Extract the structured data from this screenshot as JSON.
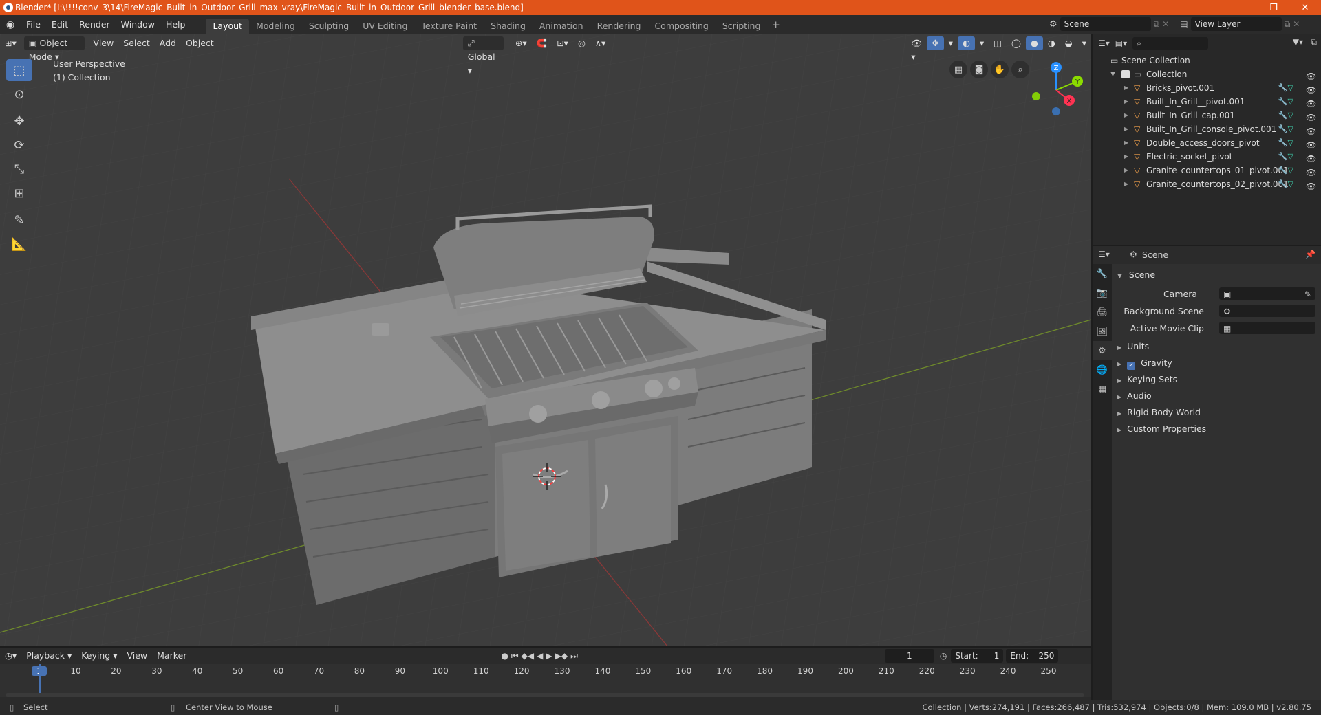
{
  "window": {
    "title": "Blender* [I:\\!!!!conv_3\\14\\FireMagic_Built_in_Outdoor_Grill_max_vray\\FireMagic_Built_in_Outdoor_Grill_blender_base.blend]",
    "controls": [
      "–",
      "❐",
      "✕"
    ]
  },
  "menu": [
    "File",
    "Edit",
    "Render",
    "Window",
    "Help"
  ],
  "workspaces": [
    "Layout",
    "Modeling",
    "Sculpting",
    "UV Editing",
    "Texture Paint",
    "Shading",
    "Animation",
    "Rendering",
    "Compositing",
    "Scripting"
  ],
  "active_workspace": "Layout",
  "scene_field": "Scene",
  "view_layer_field": "View Layer",
  "viewport": {
    "mode": "Object Mode",
    "menus": [
      "View",
      "Select",
      "Add",
      "Object"
    ],
    "transform_orientation": "Global",
    "perspective_label": "User Perspective",
    "collection_label": "(1) Collection",
    "gizmo": {
      "z": "Z",
      "y": "Y",
      "x": "X"
    }
  },
  "outliner": {
    "root": "Scene Collection",
    "collection": "Collection",
    "items": [
      "Bricks_pivot.001",
      "Built_In_Grill__pivot.001",
      "Built_In_Grill_cap.001",
      "Built_In_Grill_console_pivot.001",
      "Double_access_doors_pivot",
      "Electric_socket_pivot",
      "Granite_countertops_01_pivot.001",
      "Granite_countertops_02_pivot.001"
    ]
  },
  "properties": {
    "header": "Scene",
    "section": "Scene",
    "fields": [
      {
        "label": "Camera"
      },
      {
        "label": "Background Scene"
      },
      {
        "label": "Active Movie Clip"
      }
    ],
    "panels": [
      "Units",
      "Gravity",
      "Keying Sets",
      "Audio",
      "Rigid Body World",
      "Custom Properties"
    ]
  },
  "timeline": {
    "menus": [
      "Playback",
      "Keying",
      "View",
      "Marker"
    ],
    "current_frame": "1",
    "start_label": "Start:",
    "start": "1",
    "end_label": "End:",
    "end": "250",
    "ruler": [
      "1",
      "10",
      "20",
      "30",
      "40",
      "50",
      "60",
      "70",
      "80",
      "90",
      "100",
      "110",
      "120",
      "130",
      "140",
      "150",
      "160",
      "170",
      "180",
      "190",
      "200",
      "210",
      "220",
      "230",
      "240",
      "250"
    ]
  },
  "statusbar": {
    "left": "Select",
    "middle": "Center View to Mouse",
    "right": "Collection | Verts:274,191 | Faces:266,487 | Tris:532,974 | Objects:0/8 | Mem: 109.0 MB | v2.80.75"
  },
  "colors": {
    "titlebar": "#e0541a",
    "accent": "#4772b3",
    "x_axis": "#ff3352",
    "y_axis": "#8bdc00",
    "z_axis": "#2890ff"
  }
}
